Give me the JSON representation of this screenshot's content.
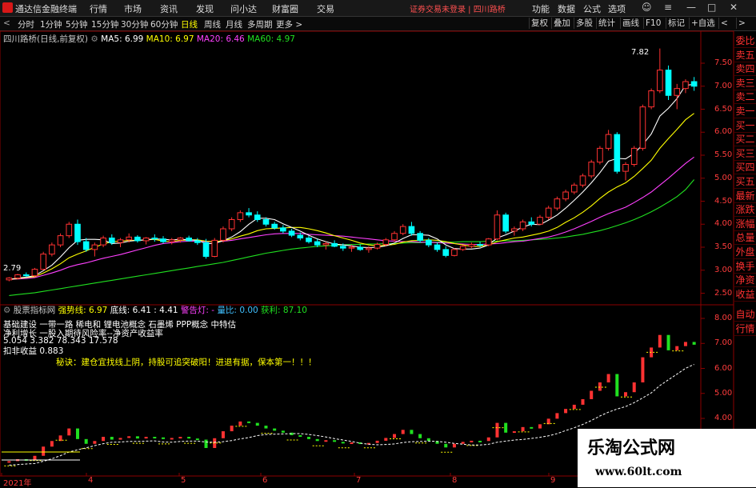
{
  "app": {
    "title": "通达信金融终端",
    "menu": [
      "行情",
      "市场",
      "资讯",
      "发现",
      "问小达",
      "财富圈",
      "交易"
    ],
    "notice": "证券交易未登录",
    "stock_name": "四川路桥",
    "right_menu": [
      "功能",
      "数据",
      "公式",
      "选项"
    ]
  },
  "toolbar": {
    "periods": [
      "分时",
      "1分钟",
      "5分钟",
      "15分钟",
      "30分钟",
      "60分钟",
      "日线",
      "周线",
      "月线",
      "多周期",
      "更多"
    ],
    "active": "日线",
    "right": [
      "复权",
      "叠加",
      "多股",
      "统计",
      "画线",
      "F10",
      "标记",
      "+自选"
    ]
  },
  "main_info": {
    "title": "四川路桥(日线,前复权)",
    "ma": [
      {
        "label": "MA5: 6.99",
        "color": "#ffffff"
      },
      {
        "label": "MA10: 6.97",
        "color": "#ffff00"
      },
      {
        "label": "MA20: 6.46",
        "color": "#ff40ff"
      },
      {
        "label": "MA60: 4.97",
        "color": "#20e020"
      }
    ]
  },
  "sub_info": {
    "title": "股票指标网",
    "items": [
      {
        "label": "强势线: 6.97",
        "color": "#ffff00"
      },
      {
        "label": "底线: 6.41 : 4.41",
        "color": "#ffffff"
      },
      {
        "label": "警告灯: -",
        "color": "#ff40ff"
      },
      {
        "label": "量比: 0.00",
        "color": "#40c0ff"
      },
      {
        "label": "获利: 87.10",
        "color": "#20e020"
      }
    ]
  },
  "signals": {
    "line1": "基础建设 一带一路 稀电和 锂电池概念 石墨烯 PPP概念 中特估",
    "line2": "净利增长 一股入期待风险率--净资产收益率",
    "line3": "5.054     3.382     78.343     17.578",
    "line4": "扣非收益 0.883",
    "advice": "秘诀：建仓宜找线上阴，持股可追突破阳！进退有据，保本第一！！！"
  },
  "side_buttons": [
    "委比",
    "卖五",
    "卖四",
    "卖三",
    "卖二",
    "卖一",
    "买一",
    "买二",
    "买三",
    "买四",
    "买五",
    "最新",
    "涨跌",
    "涨幅",
    "总量",
    "外盘",
    "换手",
    "净资",
    "收益",
    "自动",
    "行情"
  ],
  "main_axis": [
    "7.50",
    "7.00",
    "6.50",
    "6.00",
    "5.50",
    "5.00",
    "4.50",
    "4.00",
    "3.50",
    "3.00",
    "2.50"
  ],
  "sub_axis": [
    "8.00",
    "7.00",
    "6.00",
    "5.00",
    "4.00"
  ],
  "x_axis": [
    "2021年",
    "4",
    "5",
    "6",
    "7",
    "8",
    "9"
  ],
  "annotations": {
    "high": "7.82",
    "low": "2.79"
  },
  "colors": {
    "up": "#ff3232",
    "down": "#00ffff",
    "ma5": "#ffffff",
    "ma10": "#ffff00",
    "ma20": "#ff40ff",
    "ma60": "#20e020"
  },
  "watermark": {
    "cn": "乐淘公式网",
    "url": "www.60lt.com"
  },
  "chart_data": {
    "type": "candlestick",
    "title": "四川路桥(日线,前复权)",
    "ylim": [
      2.3,
      7.9
    ],
    "x_ticks": [
      "2021年",
      "4",
      "5",
      "6",
      "7",
      "8",
      "9"
    ],
    "candles": [
      [
        2.79,
        2.85,
        2.76,
        2.83
      ],
      [
        2.83,
        2.92,
        2.8,
        2.9
      ],
      [
        2.9,
        2.95,
        2.85,
        2.88
      ],
      [
        2.88,
        3.05,
        2.86,
        3.02
      ],
      [
        3.02,
        3.4,
        3.0,
        3.35
      ],
      [
        3.35,
        3.6,
        3.3,
        3.55
      ],
      [
        3.55,
        3.8,
        3.5,
        3.75
      ],
      [
        3.75,
        4.05,
        3.7,
        4.0
      ],
      [
        4.0,
        4.1,
        3.55,
        3.62
      ],
      [
        3.62,
        3.7,
        3.4,
        3.45
      ],
      [
        3.45,
        3.6,
        3.3,
        3.55
      ],
      [
        3.55,
        3.75,
        3.5,
        3.7
      ],
      [
        3.7,
        3.78,
        3.55,
        3.6
      ],
      [
        3.6,
        3.7,
        3.5,
        3.66
      ],
      [
        3.66,
        3.8,
        3.6,
        3.72
      ],
      [
        3.72,
        3.76,
        3.6,
        3.64
      ],
      [
        3.64,
        3.72,
        3.56,
        3.7
      ],
      [
        3.7,
        3.78,
        3.62,
        3.68
      ],
      [
        3.68,
        3.74,
        3.58,
        3.62
      ],
      [
        3.62,
        3.7,
        3.56,
        3.66
      ],
      [
        3.66,
        3.72,
        3.6,
        3.7
      ],
      [
        3.7,
        3.75,
        3.62,
        3.64
      ],
      [
        3.64,
        3.7,
        3.55,
        3.6
      ],
      [
        3.6,
        3.68,
        3.25,
        3.3
      ],
      [
        3.3,
        3.7,
        3.28,
        3.65
      ],
      [
        3.65,
        3.95,
        3.6,
        3.9
      ],
      [
        3.9,
        4.15,
        3.85,
        4.1
      ],
      [
        4.1,
        4.3,
        4.05,
        4.25
      ],
      [
        4.25,
        4.35,
        4.15,
        4.2
      ],
      [
        4.2,
        4.28,
        4.05,
        4.1
      ],
      [
        4.1,
        4.15,
        3.95,
        4.0
      ],
      [
        4.0,
        4.05,
        3.88,
        3.92
      ],
      [
        3.92,
        3.98,
        3.8,
        3.85
      ],
      [
        3.85,
        3.9,
        3.72,
        3.76
      ],
      [
        3.76,
        3.82,
        3.65,
        3.7
      ],
      [
        3.7,
        3.75,
        3.58,
        3.62
      ],
      [
        3.62,
        3.68,
        3.5,
        3.55
      ],
      [
        3.55,
        3.62,
        3.45,
        3.58
      ],
      [
        3.58,
        3.65,
        3.5,
        3.52
      ],
      [
        3.52,
        3.58,
        3.42,
        3.48
      ],
      [
        3.48,
        3.55,
        3.4,
        3.5
      ],
      [
        3.5,
        3.56,
        3.42,
        3.45
      ],
      [
        3.45,
        3.52,
        3.38,
        3.48
      ],
      [
        3.48,
        3.6,
        3.45,
        3.56
      ],
      [
        3.56,
        3.7,
        3.52,
        3.66
      ],
      [
        3.66,
        3.85,
        3.62,
        3.8
      ],
      [
        3.8,
        4.0,
        3.76,
        3.95
      ],
      [
        3.95,
        4.05,
        3.75,
        3.8
      ],
      [
        3.8,
        3.85,
        3.6,
        3.65
      ],
      [
        3.65,
        3.7,
        3.5,
        3.55
      ],
      [
        3.55,
        3.6,
        3.4,
        3.45
      ],
      [
        3.45,
        3.52,
        3.28,
        3.32
      ],
      [
        3.32,
        3.48,
        3.3,
        3.45
      ],
      [
        3.45,
        3.55,
        3.42,
        3.52
      ],
      [
        3.52,
        3.6,
        3.48,
        3.56
      ],
      [
        3.56,
        3.62,
        3.5,
        3.55
      ],
      [
        3.55,
        3.7,
        3.52,
        3.68
      ],
      [
        3.68,
        4.3,
        3.65,
        4.2
      ],
      [
        4.2,
        4.25,
        3.8,
        3.85
      ],
      [
        3.85,
        3.95,
        3.75,
        3.9
      ],
      [
        3.9,
        4.1,
        3.85,
        4.05
      ],
      [
        4.05,
        4.15,
        3.95,
        4.0
      ],
      [
        4.0,
        4.2,
        3.98,
        4.15
      ],
      [
        4.15,
        4.4,
        4.1,
        4.35
      ],
      [
        4.35,
        4.6,
        4.3,
        4.55
      ],
      [
        4.55,
        4.75,
        4.5,
        4.7
      ],
      [
        4.7,
        4.9,
        4.65,
        4.85
      ],
      [
        4.85,
        5.1,
        4.8,
        5.05
      ],
      [
        5.05,
        5.4,
        5.0,
        5.35
      ],
      [
        5.35,
        5.7,
        5.3,
        5.65
      ],
      [
        5.65,
        6.05,
        5.6,
        5.95
      ],
      [
        5.95,
        6.0,
        5.1,
        5.15
      ],
      [
        5.15,
        5.35,
        4.95,
        5.3
      ],
      [
        5.3,
        5.7,
        5.25,
        5.65
      ],
      [
        5.65,
        6.6,
        5.6,
        6.55
      ],
      [
        6.55,
        6.95,
        6.5,
        6.9
      ],
      [
        6.9,
        7.82,
        6.85,
        7.35
      ],
      [
        7.35,
        7.45,
        6.7,
        6.8
      ],
      [
        6.8,
        7.05,
        6.5,
        6.95
      ],
      [
        6.95,
        7.15,
        6.85,
        7.1
      ],
      [
        7.1,
        7.2,
        6.9,
        7.0
      ]
    ],
    "ma5": [
      2.8,
      2.83,
      2.85,
      2.88,
      2.99,
      3.11,
      3.29,
      3.49,
      3.65,
      3.67,
      3.67,
      3.66,
      3.58,
      3.59,
      3.63,
      3.65,
      3.66,
      3.68,
      3.67,
      3.66,
      3.67,
      3.66,
      3.65,
      3.58,
      3.58,
      3.64,
      3.72,
      3.84,
      4.0,
      4.13,
      4.13,
      4.1,
      4.01,
      3.93,
      3.85,
      3.76,
      3.68,
      3.62,
      3.57,
      3.55,
      3.53,
      3.5,
      3.49,
      3.5,
      3.53,
      3.59,
      3.69,
      3.77,
      3.77,
      3.76,
      3.68,
      3.55,
      3.47,
      3.46,
      3.46,
      3.48,
      3.55,
      3.7,
      3.77,
      3.85,
      3.94,
      4.0,
      3.99,
      4.09,
      4.2,
      4.35,
      4.52,
      4.7,
      4.9,
      5.12,
      5.37,
      5.43,
      5.42,
      5.54,
      5.73,
      5.96,
      6.35,
      6.52,
      6.73,
      7.02,
      7.04
    ],
    "ma10": [
      2.8,
      2.82,
      2.84,
      2.86,
      2.94,
      3.03,
      3.14,
      3.27,
      3.35,
      3.42,
      3.5,
      3.57,
      3.62,
      3.63,
      3.65,
      3.65,
      3.66,
      3.67,
      3.63,
      3.62,
      3.65,
      3.66,
      3.66,
      3.63,
      3.62,
      3.64,
      3.68,
      3.74,
      3.79,
      3.86,
      3.9,
      3.91,
      3.92,
      3.93,
      3.93,
      3.9,
      3.86,
      3.81,
      3.75,
      3.7,
      3.65,
      3.59,
      3.55,
      3.53,
      3.54,
      3.56,
      3.61,
      3.64,
      3.65,
      3.66,
      3.65,
      3.62,
      3.58,
      3.55,
      3.52,
      3.52,
      3.55,
      3.62,
      3.66,
      3.7,
      3.72,
      3.76,
      3.8,
      3.85,
      3.93,
      4.04,
      4.14,
      4.26,
      4.4,
      4.56,
      4.7,
      4.81,
      4.9,
      5.04,
      5.21,
      5.39,
      5.65,
      5.86,
      6.06,
      6.27,
      6.41
    ],
    "ma20": [
      2.8,
      2.81,
      2.82,
      2.84,
      2.89,
      2.94,
      3.0,
      3.07,
      3.12,
      3.16,
      3.21,
      3.26,
      3.3,
      3.34,
      3.39,
      3.44,
      3.49,
      3.54,
      3.58,
      3.6,
      3.62,
      3.63,
      3.63,
      3.62,
      3.62,
      3.63,
      3.65,
      3.68,
      3.71,
      3.74,
      3.77,
      3.79,
      3.8,
      3.8,
      3.8,
      3.78,
      3.77,
      3.76,
      3.75,
      3.74,
      3.72,
      3.7,
      3.68,
      3.66,
      3.64,
      3.63,
      3.62,
      3.62,
      3.61,
      3.61,
      3.6,
      3.59,
      3.58,
      3.57,
      3.56,
      3.56,
      3.57,
      3.58,
      3.6,
      3.62,
      3.63,
      3.66,
      3.69,
      3.72,
      3.77,
      3.83,
      3.9,
      3.98,
      4.06,
      4.15,
      4.23,
      4.3,
      4.37,
      4.47,
      4.58,
      4.7,
      4.85,
      5.0,
      5.16,
      5.32,
      5.46
    ],
    "ma60": [
      2.45,
      2.47,
      2.49,
      2.51,
      2.54,
      2.57,
      2.6,
      2.63,
      2.66,
      2.69,
      2.72,
      2.75,
      2.78,
      2.81,
      2.84,
      2.87,
      2.9,
      2.93,
      2.96,
      2.99,
      3.02,
      3.05,
      3.08,
      3.11,
      3.14,
      3.17,
      3.21,
      3.25,
      3.29,
      3.33,
      3.37,
      3.4,
      3.43,
      3.46,
      3.48,
      3.5,
      3.52,
      3.53,
      3.54,
      3.55,
      3.56,
      3.56,
      3.57,
      3.57,
      3.58,
      3.58,
      3.59,
      3.6,
      3.6,
      3.61,
      3.61,
      3.61,
      3.61,
      3.62,
      3.62,
      3.62,
      3.63,
      3.63,
      3.64,
      3.64,
      3.65,
      3.66,
      3.67,
      3.68,
      3.7,
      3.72,
      3.75,
      3.78,
      3.82,
      3.86,
      3.91,
      3.97,
      4.03,
      4.1,
      4.18,
      4.27,
      4.37,
      4.48,
      4.6,
      4.75,
      4.97
    ]
  }
}
